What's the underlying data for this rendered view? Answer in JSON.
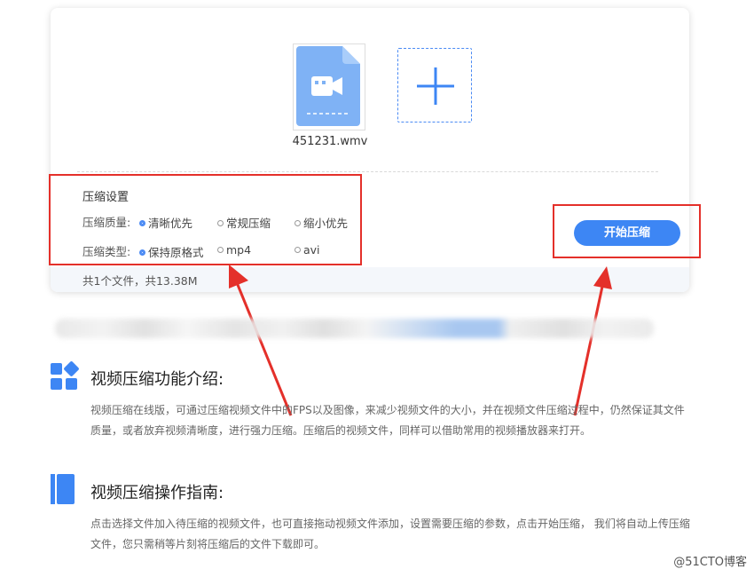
{
  "file": {
    "name": "451231.wmv",
    "icon": "video-file-icon"
  },
  "add_button": {
    "icon": "plus-icon"
  },
  "settings": {
    "title": "压缩设置",
    "quality": {
      "label": "压缩质量:",
      "options": [
        "清晰优先",
        "常规压缩",
        "缩小优先"
      ],
      "selected": "清晰优先"
    },
    "type": {
      "label": "压缩类型:",
      "options": [
        "保持原格式",
        "mp4",
        "avi"
      ],
      "selected": "保持原格式"
    }
  },
  "start_button": {
    "label": "开始压缩"
  },
  "summary": "共1个文件，共13.38M",
  "intro": {
    "title": "视频压缩功能介绍:",
    "text": "视频压缩在线版，可通过压缩视频文件中的FPS以及图像，来减少视频文件的大小，并在视频文件压缩过程中，仍然保证其文件质量，或者放弃视频清晰度，进行强力压缩。压缩后的视频文件，同样可以借助常用的视频播放器来打开。"
  },
  "guide": {
    "title": "视频压缩操作指南:",
    "text": "点击选择文件加入待压缩的视频文件，也可直接拖动视频文件添加，设置需要压缩的参数，点击开始压缩， 我们将自动上传压缩文件，您只需稍等片刻将压缩后的文件下载即可。"
  },
  "watermark": "@51CTO博客",
  "colors": {
    "accent": "#3d86f4",
    "annotation": "#e4302a",
    "file_icon": "#7fb2f5"
  }
}
